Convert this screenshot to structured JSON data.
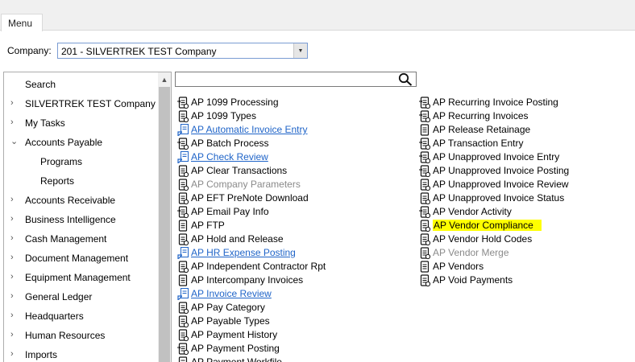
{
  "menu_tab": "Menu",
  "company": {
    "label": "Company:",
    "value": "201 - SILVERTREK TEST Company"
  },
  "nav": {
    "items": [
      {
        "label": "Search",
        "arrow": ""
      },
      {
        "label": "SILVERTREK TEST Company",
        "arrow": "›"
      },
      {
        "label": "My Tasks",
        "arrow": "›"
      },
      {
        "label": "Accounts Payable",
        "arrow": "⌄"
      },
      {
        "label": "Programs",
        "arrow": ""
      },
      {
        "label": "Reports",
        "arrow": ""
      },
      {
        "label": "Accounts Receivable",
        "arrow": "›"
      },
      {
        "label": "Business Intelligence",
        "arrow": "›"
      },
      {
        "label": "Cash Management",
        "arrow": "›"
      },
      {
        "label": "Document Management",
        "arrow": "›"
      },
      {
        "label": "Equipment Management",
        "arrow": "›"
      },
      {
        "label": "General Ledger",
        "arrow": "›"
      },
      {
        "label": "Headquarters",
        "arrow": "›"
      },
      {
        "label": "Human Resources",
        "arrow": "›"
      },
      {
        "label": "Imports",
        "arrow": "›"
      }
    ]
  },
  "search": {
    "value": ""
  },
  "programs_left": [
    {
      "label": "AP 1099 Processing",
      "icon": "process-icon",
      "state": "normal"
    },
    {
      "label": "AP 1099 Types",
      "icon": "form-icon",
      "state": "normal"
    },
    {
      "label": "AP Automatic Invoice Entry",
      "icon": "shortcut-icon",
      "state": "link"
    },
    {
      "label": "AP Batch Process",
      "icon": "process-icon",
      "state": "normal"
    },
    {
      "label": "AP Check Review",
      "icon": "shortcut-icon",
      "state": "link"
    },
    {
      "label": "AP Clear Transactions",
      "icon": "form-icon",
      "state": "normal"
    },
    {
      "label": "AP Company Parameters",
      "icon": "form-icon",
      "state": "disabled"
    },
    {
      "label": "AP EFT PreNote Download",
      "icon": "form-icon",
      "state": "normal"
    },
    {
      "label": "AP Email Pay Info",
      "icon": "process-icon",
      "state": "normal"
    },
    {
      "label": "AP FTP",
      "icon": "doc-icon",
      "state": "normal"
    },
    {
      "label": "AP Hold and Release",
      "icon": "form-icon",
      "state": "normal"
    },
    {
      "label": "AP HR Expense Posting",
      "icon": "shortcut-icon",
      "state": "link"
    },
    {
      "label": "AP Independent Contractor Rpt",
      "icon": "form-icon",
      "state": "normal"
    },
    {
      "label": "AP Intercompany Invoices",
      "icon": "doc-icon",
      "state": "normal"
    },
    {
      "label": "AP Invoice Review",
      "icon": "shortcut-icon",
      "state": "link"
    },
    {
      "label": "AP Pay Category",
      "icon": "form-icon",
      "state": "normal"
    },
    {
      "label": "AP Payable Types",
      "icon": "form-icon",
      "state": "normal"
    },
    {
      "label": "AP Payment History",
      "icon": "form-icon",
      "state": "normal"
    },
    {
      "label": "AP Payment Posting",
      "icon": "process-icon",
      "state": "normal"
    },
    {
      "label": "AP Payment Workfile",
      "icon": "form-icon",
      "state": "normal"
    }
  ],
  "programs_right": [
    {
      "label": "AP Recurring Invoice Posting",
      "icon": "process-icon",
      "state": "normal"
    },
    {
      "label": "AP Recurring Invoices",
      "icon": "process-icon",
      "state": "normal"
    },
    {
      "label": "AP Release Retainage",
      "icon": "doc-icon",
      "state": "normal"
    },
    {
      "label": "AP Transaction Entry",
      "icon": "process-icon",
      "state": "normal"
    },
    {
      "label": "AP Unapproved Invoice Entry",
      "icon": "process-icon",
      "state": "normal"
    },
    {
      "label": "AP Unapproved Invoice Posting",
      "icon": "process-icon",
      "state": "normal"
    },
    {
      "label": "AP Unapproved Invoice Review",
      "icon": "form-icon",
      "state": "normal"
    },
    {
      "label": "AP Unapproved Invoice Status",
      "icon": "form-icon",
      "state": "normal"
    },
    {
      "label": "AP Vendor Activity",
      "icon": "process-icon",
      "state": "normal"
    },
    {
      "label": "AP Vendor Compliance",
      "icon": "form-icon",
      "state": "highlight"
    },
    {
      "label": "AP Vendor Hold Codes",
      "icon": "form-icon",
      "state": "normal"
    },
    {
      "label": "AP Vendor Merge",
      "icon": "form-icon",
      "state": "disabled"
    },
    {
      "label": "AP Vendors",
      "icon": "doc-icon",
      "state": "normal"
    },
    {
      "label": "AP Void Payments",
      "icon": "form-icon",
      "state": "normal"
    }
  ],
  "colors": {
    "link": "#1f64c8",
    "disabled": "#8a8a8a",
    "highlight": "#ffff00",
    "accent_border": "#7a9cd3"
  }
}
